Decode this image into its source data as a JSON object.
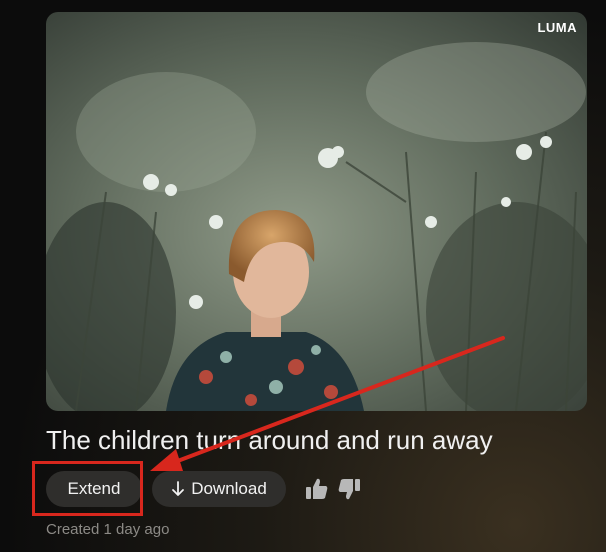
{
  "card": {
    "brand": "LUMA"
  },
  "video": {
    "title": "The children turn around and run away",
    "created": "Created 1 day ago"
  },
  "actions": {
    "extend_label": "Extend",
    "download_label": "Download"
  },
  "icons": {
    "download": "download-arrow-icon",
    "like": "thumbs-up-icon",
    "dislike": "thumbs-down-icon"
  },
  "colors": {
    "annotation": "#d8271d",
    "button_bg": "#2f2e2c"
  }
}
